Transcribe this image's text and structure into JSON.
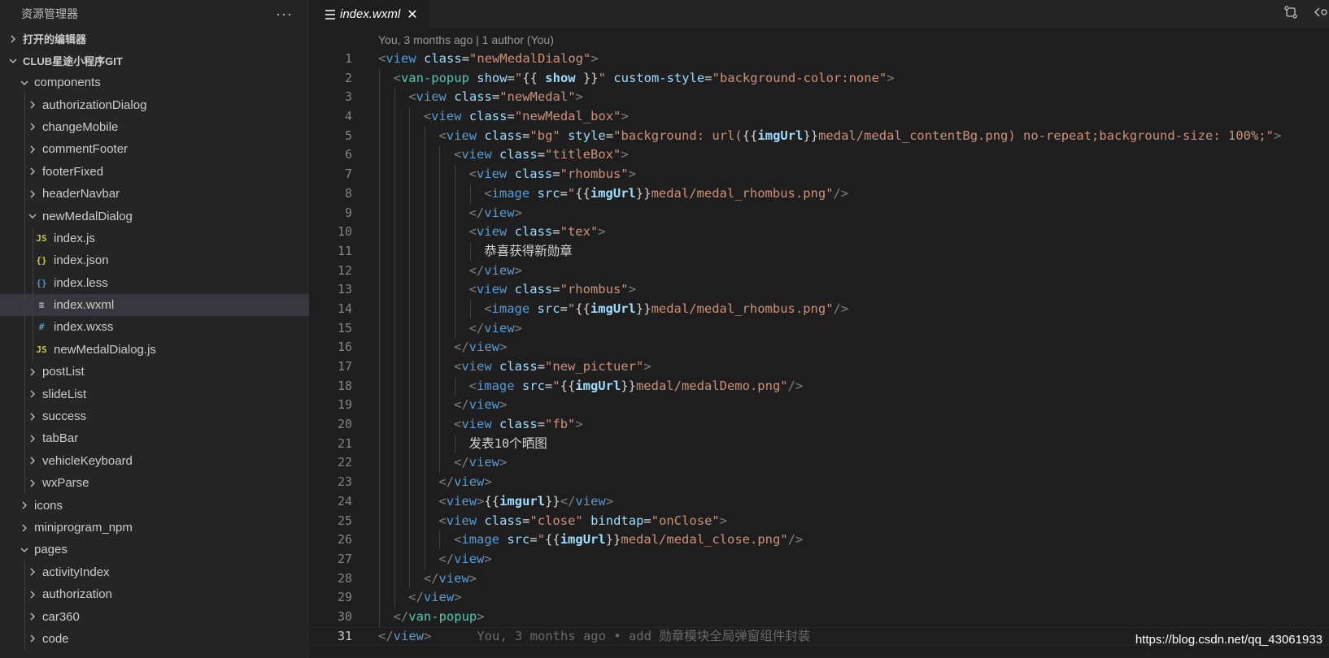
{
  "sidebar": {
    "title": "资源管理器",
    "more": "···",
    "open_editors": "打开的编辑器",
    "workspace": "CLUB星途小程序GIT",
    "tree": [
      {
        "label": "components",
        "depth": 1,
        "kind": "folder",
        "open": true
      },
      {
        "label": "authorizationDialog",
        "depth": 2,
        "kind": "folder",
        "open": false
      },
      {
        "label": "changeMobile",
        "depth": 2,
        "kind": "folder",
        "open": false
      },
      {
        "label": "commentFooter",
        "depth": 2,
        "kind": "folder",
        "open": false
      },
      {
        "label": "footerFixed",
        "depth": 2,
        "kind": "folder",
        "open": false
      },
      {
        "label": "headerNavbar",
        "depth": 2,
        "kind": "folder",
        "open": false
      },
      {
        "label": "newMedalDialog",
        "depth": 2,
        "kind": "folder",
        "open": true
      },
      {
        "label": "index.js",
        "depth": 3,
        "kind": "file",
        "icon": "JS",
        "icon_color": "#cbcb41"
      },
      {
        "label": "index.json",
        "depth": 3,
        "kind": "file",
        "icon": "{}",
        "icon_color": "#cbcb41"
      },
      {
        "label": "index.less",
        "depth": 3,
        "kind": "file",
        "icon": "{}",
        "icon_color": "#519aba"
      },
      {
        "label": "index.wxml",
        "depth": 3,
        "kind": "file",
        "icon": "≡",
        "icon_color": "#c5c5c5",
        "selected": true
      },
      {
        "label": "index.wxss",
        "depth": 3,
        "kind": "file",
        "icon": "#",
        "icon_color": "#519aba"
      },
      {
        "label": "newMedalDialog.js",
        "depth": 3,
        "kind": "file",
        "icon": "JS",
        "icon_color": "#cbcb41"
      },
      {
        "label": "postList",
        "depth": 2,
        "kind": "folder",
        "open": false
      },
      {
        "label": "slideList",
        "depth": 2,
        "kind": "folder",
        "open": false
      },
      {
        "label": "success",
        "depth": 2,
        "kind": "folder",
        "open": false
      },
      {
        "label": "tabBar",
        "depth": 2,
        "kind": "folder",
        "open": false
      },
      {
        "label": "vehicleKeyboard",
        "depth": 2,
        "kind": "folder",
        "open": false
      },
      {
        "label": "wxParse",
        "depth": 2,
        "kind": "folder",
        "open": false
      },
      {
        "label": "icons",
        "depth": 1,
        "kind": "folder",
        "open": false
      },
      {
        "label": "miniprogram_npm",
        "depth": 1,
        "kind": "folder",
        "open": false
      },
      {
        "label": "pages",
        "depth": 1,
        "kind": "folder",
        "open": true
      },
      {
        "label": "activityIndex",
        "depth": 2,
        "kind": "folder",
        "open": false
      },
      {
        "label": "authorization",
        "depth": 2,
        "kind": "folder",
        "open": false
      },
      {
        "label": "car360",
        "depth": 2,
        "kind": "folder",
        "open": false
      },
      {
        "label": "code",
        "depth": 2,
        "kind": "folder",
        "open": false
      }
    ]
  },
  "editor": {
    "tab_label": "index.wxml",
    "tab_close": "✕",
    "codelens": "You, 3 months ago | 1 author (You)",
    "current_line": 31,
    "lines": [
      {
        "n": 1,
        "indent": 0,
        "tokens": [
          [
            "t-punc",
            "<"
          ],
          [
            "t-tag",
            "view "
          ],
          [
            "t-attr",
            "class"
          ],
          [
            "t-text",
            "="
          ],
          [
            "t-str",
            "\"newMedalDialog\""
          ],
          [
            "t-punc",
            ">"
          ]
        ]
      },
      {
        "n": 2,
        "indent": 1,
        "tokens": [
          [
            "t-punc",
            "<"
          ],
          [
            "t-tag2",
            "van-popup "
          ],
          [
            "t-attr",
            "show"
          ],
          [
            "t-text",
            "="
          ],
          [
            "t-str",
            "\""
          ],
          [
            "t-text",
            "{{ "
          ],
          [
            "t-expr",
            "show"
          ],
          [
            "t-text",
            " }}"
          ],
          [
            "t-str",
            "\" "
          ],
          [
            "t-attr",
            "custom-style"
          ],
          [
            "t-text",
            "="
          ],
          [
            "t-str",
            "\"background-color:none\""
          ],
          [
            "t-punc",
            ">"
          ]
        ]
      },
      {
        "n": 3,
        "indent": 2,
        "tokens": [
          [
            "t-punc",
            "<"
          ],
          [
            "t-tag",
            "view "
          ],
          [
            "t-attr",
            "class"
          ],
          [
            "t-text",
            "="
          ],
          [
            "t-str",
            "\"newMedal\""
          ],
          [
            "t-punc",
            ">"
          ]
        ]
      },
      {
        "n": 4,
        "indent": 3,
        "tokens": [
          [
            "t-punc",
            "<"
          ],
          [
            "t-tag",
            "view "
          ],
          [
            "t-attr",
            "class"
          ],
          [
            "t-text",
            "="
          ],
          [
            "t-str",
            "\"newMedal_box\""
          ],
          [
            "t-punc",
            ">"
          ]
        ]
      },
      {
        "n": 5,
        "indent": 4,
        "tokens": [
          [
            "t-punc",
            "<"
          ],
          [
            "t-tag",
            "view "
          ],
          [
            "t-attr",
            "class"
          ],
          [
            "t-text",
            "="
          ],
          [
            "t-str",
            "\"bg\" "
          ],
          [
            "t-attr",
            "style"
          ],
          [
            "t-text",
            "="
          ],
          [
            "t-str",
            "\"background: url("
          ],
          [
            "t-text",
            "{{"
          ],
          [
            "t-expr",
            "imgUrl"
          ],
          [
            "t-text",
            "}}"
          ],
          [
            "t-str",
            "medal/medal_contentBg.png) no-repeat;background-size: 100%;\""
          ],
          [
            "t-punc",
            ">"
          ]
        ]
      },
      {
        "n": 6,
        "indent": 5,
        "tokens": [
          [
            "t-punc",
            "<"
          ],
          [
            "t-tag",
            "view "
          ],
          [
            "t-attr",
            "class"
          ],
          [
            "t-text",
            "="
          ],
          [
            "t-str",
            "\"titleBox\""
          ],
          [
            "t-punc",
            ">"
          ]
        ]
      },
      {
        "n": 7,
        "indent": 6,
        "tokens": [
          [
            "t-punc",
            "<"
          ],
          [
            "t-tag",
            "view "
          ],
          [
            "t-attr",
            "class"
          ],
          [
            "t-text",
            "="
          ],
          [
            "t-str",
            "\"rhombus\""
          ],
          [
            "t-punc",
            ">"
          ]
        ]
      },
      {
        "n": 8,
        "indent": 7,
        "tokens": [
          [
            "t-punc",
            "<"
          ],
          [
            "t-tag",
            "image "
          ],
          [
            "t-attr",
            "src"
          ],
          [
            "t-text",
            "="
          ],
          [
            "t-str",
            "\""
          ],
          [
            "t-text",
            "{{"
          ],
          [
            "t-expr",
            "imgUrl"
          ],
          [
            "t-text",
            "}}"
          ],
          [
            "t-str",
            "medal/medal_rhombus.png\""
          ],
          [
            "t-punc",
            "/>"
          ]
        ]
      },
      {
        "n": 9,
        "indent": 6,
        "tokens": [
          [
            "t-punc",
            "</"
          ],
          [
            "t-tag",
            "view"
          ],
          [
            "t-punc",
            ">"
          ]
        ]
      },
      {
        "n": 10,
        "indent": 6,
        "tokens": [
          [
            "t-punc",
            "<"
          ],
          [
            "t-tag",
            "view "
          ],
          [
            "t-attr",
            "class"
          ],
          [
            "t-text",
            "="
          ],
          [
            "t-str",
            "\"tex\""
          ],
          [
            "t-punc",
            ">"
          ]
        ]
      },
      {
        "n": 11,
        "indent": 7,
        "tokens": [
          [
            "t-text",
            "恭喜获得新勋章"
          ]
        ]
      },
      {
        "n": 12,
        "indent": 6,
        "tokens": [
          [
            "t-punc",
            "</"
          ],
          [
            "t-tag",
            "view"
          ],
          [
            "t-punc",
            ">"
          ]
        ]
      },
      {
        "n": 13,
        "indent": 6,
        "tokens": [
          [
            "t-punc",
            "<"
          ],
          [
            "t-tag",
            "view "
          ],
          [
            "t-attr",
            "class"
          ],
          [
            "t-text",
            "="
          ],
          [
            "t-str",
            "\"rhombus\""
          ],
          [
            "t-punc",
            ">"
          ]
        ]
      },
      {
        "n": 14,
        "indent": 7,
        "tokens": [
          [
            "t-punc",
            "<"
          ],
          [
            "t-tag",
            "image "
          ],
          [
            "t-attr",
            "src"
          ],
          [
            "t-text",
            "="
          ],
          [
            "t-str",
            "\""
          ],
          [
            "t-text",
            "{{"
          ],
          [
            "t-expr",
            "imgUrl"
          ],
          [
            "t-text",
            "}}"
          ],
          [
            "t-str",
            "medal/medal_rhombus.png\""
          ],
          [
            "t-punc",
            "/>"
          ]
        ]
      },
      {
        "n": 15,
        "indent": 6,
        "tokens": [
          [
            "t-punc",
            "</"
          ],
          [
            "t-tag",
            "view"
          ],
          [
            "t-punc",
            ">"
          ]
        ]
      },
      {
        "n": 16,
        "indent": 5,
        "tokens": [
          [
            "t-punc",
            "</"
          ],
          [
            "t-tag",
            "view"
          ],
          [
            "t-punc",
            ">"
          ]
        ]
      },
      {
        "n": 17,
        "indent": 5,
        "tokens": [
          [
            "t-punc",
            "<"
          ],
          [
            "t-tag",
            "view "
          ],
          [
            "t-attr",
            "class"
          ],
          [
            "t-text",
            "="
          ],
          [
            "t-str",
            "\"new_pictuer\""
          ],
          [
            "t-punc",
            ">"
          ]
        ]
      },
      {
        "n": 18,
        "indent": 6,
        "tokens": [
          [
            "t-punc",
            "<"
          ],
          [
            "t-tag",
            "image "
          ],
          [
            "t-attr",
            "src"
          ],
          [
            "t-text",
            "="
          ],
          [
            "t-str",
            "\""
          ],
          [
            "t-text",
            "{{"
          ],
          [
            "t-expr",
            "imgUrl"
          ],
          [
            "t-text",
            "}}"
          ],
          [
            "t-str",
            "medal/medalDemo.png\""
          ],
          [
            "t-punc",
            "/>"
          ]
        ]
      },
      {
        "n": 19,
        "indent": 5,
        "tokens": [
          [
            "t-punc",
            "</"
          ],
          [
            "t-tag",
            "view"
          ],
          [
            "t-punc",
            ">"
          ]
        ]
      },
      {
        "n": 20,
        "indent": 5,
        "tokens": [
          [
            "t-punc",
            "<"
          ],
          [
            "t-tag",
            "view "
          ],
          [
            "t-attr",
            "class"
          ],
          [
            "t-text",
            "="
          ],
          [
            "t-str",
            "\"fb\""
          ],
          [
            "t-punc",
            ">"
          ]
        ]
      },
      {
        "n": 21,
        "indent": 6,
        "tokens": [
          [
            "t-text",
            "发表10个晒图"
          ]
        ]
      },
      {
        "n": 22,
        "indent": 5,
        "tokens": [
          [
            "t-punc",
            "</"
          ],
          [
            "t-tag",
            "view"
          ],
          [
            "t-punc",
            ">"
          ]
        ]
      },
      {
        "n": 23,
        "indent": 4,
        "tokens": [
          [
            "t-punc",
            "</"
          ],
          [
            "t-tag",
            "view"
          ],
          [
            "t-punc",
            ">"
          ]
        ]
      },
      {
        "n": 24,
        "indent": 4,
        "tokens": [
          [
            "t-punc",
            "<"
          ],
          [
            "t-tag",
            "view"
          ],
          [
            "t-punc",
            ">"
          ],
          [
            "t-text",
            "{{"
          ],
          [
            "t-expr",
            "imgurl"
          ],
          [
            "t-text",
            "}}"
          ],
          [
            "t-punc",
            "</"
          ],
          [
            "t-tag",
            "view"
          ],
          [
            "t-punc",
            ">"
          ]
        ]
      },
      {
        "n": 25,
        "indent": 4,
        "tokens": [
          [
            "t-punc",
            "<"
          ],
          [
            "t-tag",
            "view "
          ],
          [
            "t-attr",
            "class"
          ],
          [
            "t-text",
            "="
          ],
          [
            "t-str",
            "\"close\" "
          ],
          [
            "t-attr",
            "bindtap"
          ],
          [
            "t-text",
            "="
          ],
          [
            "t-str",
            "\"onClose\""
          ],
          [
            "t-punc",
            ">"
          ]
        ]
      },
      {
        "n": 26,
        "indent": 5,
        "tokens": [
          [
            "t-punc",
            "<"
          ],
          [
            "t-tag",
            "image "
          ],
          [
            "t-attr",
            "src"
          ],
          [
            "t-text",
            "="
          ],
          [
            "t-str",
            "\""
          ],
          [
            "t-text",
            "{{"
          ],
          [
            "t-expr",
            "imgUrl"
          ],
          [
            "t-text",
            "}}"
          ],
          [
            "t-str",
            "medal/medal_close.png\""
          ],
          [
            "t-punc",
            "/>"
          ]
        ]
      },
      {
        "n": 27,
        "indent": 4,
        "tokens": [
          [
            "t-punc",
            "</"
          ],
          [
            "t-tag",
            "view"
          ],
          [
            "t-punc",
            ">"
          ]
        ]
      },
      {
        "n": 28,
        "indent": 3,
        "tokens": [
          [
            "t-punc",
            "</"
          ],
          [
            "t-tag",
            "view"
          ],
          [
            "t-punc",
            ">"
          ]
        ]
      },
      {
        "n": 29,
        "indent": 2,
        "tokens": [
          [
            "t-punc",
            "</"
          ],
          [
            "t-tag",
            "view"
          ],
          [
            "t-punc",
            ">"
          ]
        ]
      },
      {
        "n": 30,
        "indent": 1,
        "tokens": [
          [
            "t-punc",
            "</"
          ],
          [
            "t-tag2",
            "van-popup"
          ],
          [
            "t-punc",
            ">"
          ]
        ]
      },
      {
        "n": 31,
        "indent": 0,
        "tokens": [
          [
            "t-punc",
            "</"
          ],
          [
            "t-tag",
            "view"
          ],
          [
            "t-punc",
            ">"
          ],
          [
            "t-blame",
            "      You, 3 months ago • add 勋章模块全局弹窗组件封装"
          ]
        ]
      }
    ]
  },
  "watermark": "https://blog.csdn.net/qq_43061933"
}
